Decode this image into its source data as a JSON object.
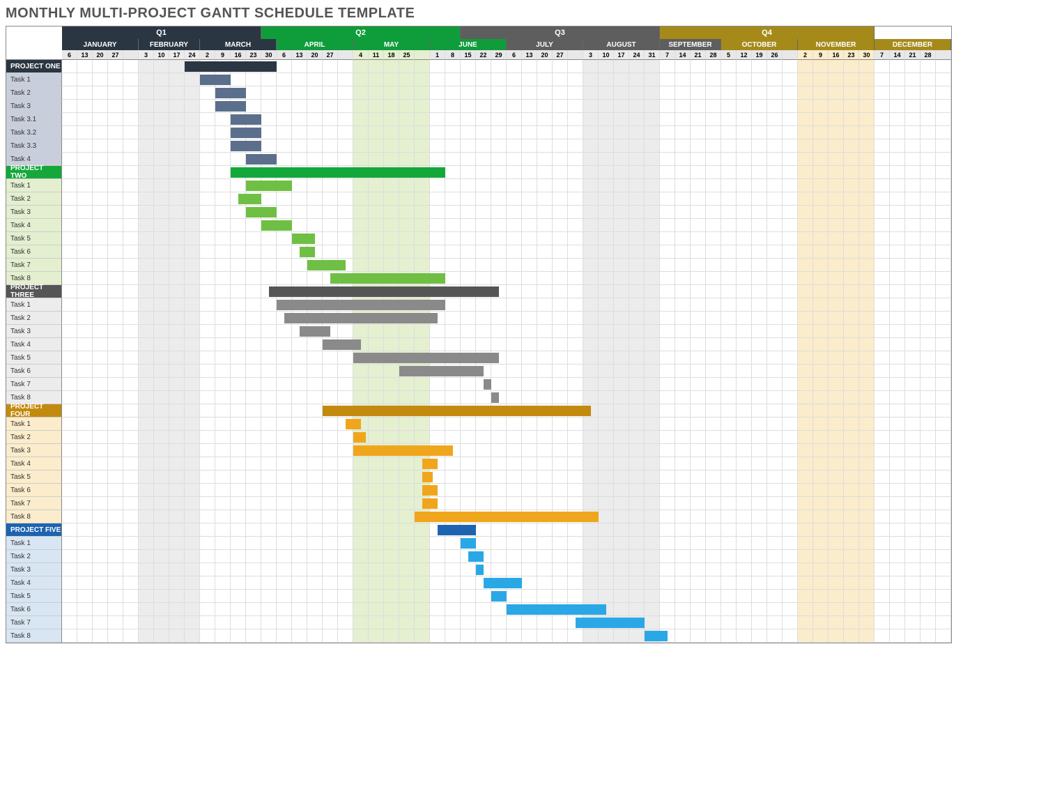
{
  "title": "MONTHLY MULTI-PROJECT GANTT SCHEDULE TEMPLATE",
  "cellWidth": 22,
  "quarters": [
    {
      "name": "Q1",
      "bg": "#2b3643",
      "span": 13
    },
    {
      "name": "Q2",
      "bg": "#0f9c3a",
      "span": 13
    },
    {
      "name": "Q3",
      "bg": "#5e5e5e",
      "span": 13
    },
    {
      "name": "Q4",
      "bg": "#a58a1a",
      "span": 14
    }
  ],
  "months": [
    {
      "name": "JANUARY",
      "bg": "#2b3643",
      "days": [
        6,
        13,
        20,
        27
      ],
      "extra": 1
    },
    {
      "name": "FEBRUARY",
      "bg": "#2b3643",
      "days": [
        3,
        10,
        17,
        24
      ],
      "extra": 0
    },
    {
      "name": "MARCH",
      "bg": "#2b3643",
      "days": [
        2,
        9,
        16,
        23,
        30
      ],
      "extra": 0
    },
    {
      "name": "APRIL",
      "bg": "#0f9c3a",
      "days": [
        6,
        13,
        20,
        27
      ],
      "extra": 1
    },
    {
      "name": "MAY",
      "bg": "#0f9c3a",
      "days": [
        4,
        11,
        18,
        25
      ],
      "extra": 1
    },
    {
      "name": "JUNE",
      "bg": "#0f9c3a",
      "days": [
        1,
        8,
        15,
        22,
        29
      ],
      "extra": 0
    },
    {
      "name": "JULY",
      "bg": "#5e5e5e",
      "days": [
        6,
        13,
        20,
        27
      ],
      "extra": 1
    },
    {
      "name": "AUGUST",
      "bg": "#5e5e5e",
      "days": [
        3,
        10,
        17,
        24,
        31
      ],
      "extra": 0
    },
    {
      "name": "SEPTEMBER",
      "bg": "#5e5e5e",
      "days": [
        7,
        14,
        21,
        28
      ],
      "extra": 0
    },
    {
      "name": "OCTOBER",
      "bg": "#a58a1a",
      "days": [
        5,
        12,
        19,
        26
      ],
      "extra": 1
    },
    {
      "name": "NOVEMBER",
      "bg": "#a58a1a",
      "days": [
        2,
        9,
        16,
        23,
        30
      ],
      "extra": 0
    },
    {
      "name": "DECEMBER",
      "bg": "#a58a1a",
      "days": [
        7,
        14,
        21,
        28
      ],
      "extra": 1
    }
  ],
  "bandColors": {
    "quarterBg": [
      "#fff",
      "#fff",
      "#fff",
      "#fff"
    ],
    "monthShade": {
      "FEBRUARY": "#ececec",
      "MAY": "#e4f0cf",
      "AUGUST": "#ececec",
      "NOVEMBER": "#fbeccb"
    }
  },
  "dayHeaderBg": "#e8e8e8",
  "projects": [
    {
      "name": "PROJECT ONE",
      "hdrBg": "#2b3643",
      "hdrFg": "#fff",
      "rowBg": "#c8cedc",
      "barColor": "#394b63",
      "barMid": "#5b6e8c",
      "rows": [
        {
          "label": "PROJECT ONE",
          "isHeader": true,
          "bar": {
            "start": 8,
            "len": 6,
            "color": "#2b3643"
          }
        },
        {
          "label": "Task 1",
          "bar": {
            "start": 9,
            "len": 2,
            "color": "#5b6e8c"
          }
        },
        {
          "label": "Task 2",
          "bar": {
            "start": 10,
            "len": 2,
            "color": "#5b6e8c"
          }
        },
        {
          "label": "Task 3",
          "bar": {
            "start": 10,
            "len": 2,
            "color": "#5b6e8c"
          }
        },
        {
          "label": "Task 3.1",
          "bar": {
            "start": 11,
            "len": 2,
            "color": "#5b6e8c"
          }
        },
        {
          "label": "Task 3.2",
          "bar": {
            "start": 11,
            "len": 2,
            "color": "#5b6e8c"
          }
        },
        {
          "label": "Task 3.3",
          "bar": {
            "start": 11,
            "len": 2,
            "color": "#5b6e8c"
          }
        },
        {
          "label": "Task 4",
          "bar": {
            "start": 12,
            "len": 2,
            "color": "#5b6e8c"
          }
        }
      ]
    },
    {
      "name": "PROJECT TWO",
      "hdrBg": "#14a83b",
      "hdrFg": "#fff",
      "rowBg": "#e3efcf",
      "barColor": "#14a83b",
      "barMid": "#6fbf44",
      "rows": [
        {
          "label": "PROJECT TWO",
          "isHeader": true,
          "bar": {
            "start": 11,
            "len": 14,
            "color": "#14a83b"
          }
        },
        {
          "label": "Task 1",
          "bar": {
            "start": 12,
            "len": 3,
            "color": "#6fbf44"
          }
        },
        {
          "label": "Task 2",
          "bar": {
            "start": 11.5,
            "len": 1.5,
            "color": "#6fbf44"
          }
        },
        {
          "label": "Task 3",
          "bar": {
            "start": 12,
            "len": 2,
            "color": "#6fbf44"
          }
        },
        {
          "label": "Task 4",
          "bar": {
            "start": 13,
            "len": 2,
            "color": "#6fbf44"
          }
        },
        {
          "label": "Task 5",
          "bar": {
            "start": 15,
            "len": 1.5,
            "color": "#6fbf44"
          }
        },
        {
          "label": "Task 6",
          "bar": {
            "start": 15.5,
            "len": 1,
            "color": "#6fbf44"
          }
        },
        {
          "label": "Task 7",
          "bar": {
            "start": 16,
            "len": 2.5,
            "color": "#6fbf44"
          }
        },
        {
          "label": "Task 8",
          "bar": {
            "start": 17.5,
            "len": 7.5,
            "color": "#6fbf44"
          }
        }
      ]
    },
    {
      "name": "PROJECT THREE",
      "hdrBg": "#555",
      "hdrFg": "#fff",
      "rowBg": "#ececec",
      "barColor": "#555",
      "barMid": "#8a8a8a",
      "rows": [
        {
          "label": "PROJECT THREE",
          "isHeader": true,
          "bar": {
            "start": 13.5,
            "len": 15,
            "color": "#555"
          }
        },
        {
          "label": "Task 1",
          "bar": {
            "start": 14,
            "len": 11,
            "color": "#8a8a8a"
          }
        },
        {
          "label": "Task 2",
          "bar": {
            "start": 14.5,
            "len": 10,
            "color": "#8a8a8a"
          }
        },
        {
          "label": "Task 3",
          "bar": {
            "start": 15.5,
            "len": 2,
            "color": "#8a8a8a"
          }
        },
        {
          "label": "Task 4",
          "bar": {
            "start": 17,
            "len": 2.5,
            "color": "#8a8a8a"
          }
        },
        {
          "label": "Task 5",
          "bar": {
            "start": 19,
            "len": 9.5,
            "color": "#8a8a8a"
          }
        },
        {
          "label": "Task 6",
          "bar": {
            "start": 22,
            "len": 5.5,
            "color": "#8a8a8a"
          }
        },
        {
          "label": "Task 7",
          "bar": {
            "start": 27.5,
            "len": 0.5,
            "color": "#8a8a8a"
          }
        },
        {
          "label": "Task 8",
          "bar": {
            "start": 28,
            "len": 0.5,
            "color": "#8a8a8a"
          }
        }
      ]
    },
    {
      "name": "PROJECT FOUR",
      "hdrBg": "#c28a0e",
      "hdrFg": "#fff",
      "rowBg": "#fbeccb",
      "barColor": "#c28a0e",
      "barMid": "#f0a61c",
      "rows": [
        {
          "label": "PROJECT FOUR",
          "isHeader": true,
          "bar": {
            "start": 17,
            "len": 17.5,
            "color": "#c28a0e"
          }
        },
        {
          "label": "Task 1",
          "bar": {
            "start": 18.5,
            "len": 1,
            "color": "#f0a61c"
          }
        },
        {
          "label": "Task 2",
          "bar": {
            "start": 19,
            "len": 0.8,
            "color": "#f0a61c"
          }
        },
        {
          "label": "Task 3",
          "bar": {
            "start": 19,
            "len": 6.5,
            "color": "#f0a61c"
          }
        },
        {
          "label": "Task 4",
          "bar": {
            "start": 23.5,
            "len": 1,
            "color": "#f0a61c"
          }
        },
        {
          "label": "Task 5",
          "bar": {
            "start": 23.5,
            "len": 0.7,
            "color": "#f0a61c"
          }
        },
        {
          "label": "Task 6",
          "bar": {
            "start": 23.5,
            "len": 1,
            "color": "#f0a61c"
          }
        },
        {
          "label": "Task 7",
          "bar": {
            "start": 23.5,
            "len": 1,
            "color": "#f0a61c"
          }
        },
        {
          "label": "Task 8",
          "bar": {
            "start": 23,
            "len": 12,
            "color": "#f0a61c"
          }
        }
      ]
    },
    {
      "name": "PROJECT FIVE",
      "hdrBg": "#1e63b0",
      "hdrFg": "#fff",
      "rowBg": "#d8e6f3",
      "barColor": "#1e63b0",
      "barMid": "#2aa8e6",
      "rows": [
        {
          "label": "PROJECT FIVE",
          "isHeader": true,
          "bar": {
            "start": 24.5,
            "len": 2.5,
            "color": "#1e63b0"
          }
        },
        {
          "label": "Task 1",
          "bar": {
            "start": 26,
            "len": 1,
            "color": "#2aa8e6"
          }
        },
        {
          "label": "Task 2",
          "bar": {
            "start": 26.5,
            "len": 1,
            "color": "#2aa8e6"
          }
        },
        {
          "label": "Task 3",
          "bar": {
            "start": 27,
            "len": 0.5,
            "color": "#2aa8e6"
          }
        },
        {
          "label": "Task 4",
          "bar": {
            "start": 27.5,
            "len": 2.5,
            "color": "#2aa8e6"
          }
        },
        {
          "label": "Task 5",
          "bar": {
            "start": 28,
            "len": 1,
            "color": "#2aa8e6"
          }
        },
        {
          "label": "Task 6",
          "bar": {
            "start": 29,
            "len": 6.5,
            "color": "#2aa8e6"
          }
        },
        {
          "label": "Task 7",
          "bar": {
            "start": 33.5,
            "len": 4.5,
            "color": "#2aa8e6"
          }
        },
        {
          "label": "Task 8",
          "bar": {
            "start": 38,
            "len": 1.5,
            "color": "#2aa8e6"
          }
        }
      ]
    }
  ],
  "chart_data": {
    "type": "gantt",
    "title": "MONTHLY MULTI-PROJECT GANTT SCHEDULE TEMPLATE",
    "x_unit": "week_index (0 = first week column)",
    "columns_total": 53,
    "quarters": [
      "Q1",
      "Q2",
      "Q3",
      "Q4"
    ],
    "months": [
      "JANUARY",
      "FEBRUARY",
      "MARCH",
      "APRIL",
      "MAY",
      "JUNE",
      "JULY",
      "AUGUST",
      "SEPTEMBER",
      "OCTOBER",
      "NOVEMBER",
      "DECEMBER"
    ],
    "week_labels": [
      6,
      13,
      20,
      27,
      null,
      3,
      10,
      17,
      24,
      2,
      9,
      16,
      23,
      30,
      6,
      13,
      20,
      27,
      null,
      4,
      11,
      18,
      25,
      null,
      1,
      8,
      15,
      22,
      29,
      6,
      13,
      20,
      27,
      null,
      3,
      10,
      17,
      24,
      31,
      7,
      14,
      21,
      28,
      5,
      12,
      19,
      26,
      null,
      2,
      9,
      16,
      23,
      30,
      7,
      14,
      21,
      28,
      null
    ],
    "series": [
      {
        "name": "PROJECT ONE",
        "color": "#2b3643",
        "tasks": [
          {
            "name": "(summary)",
            "start": 8,
            "end": 14
          },
          {
            "name": "Task 1",
            "start": 9,
            "end": 11
          },
          {
            "name": "Task 2",
            "start": 10,
            "end": 12
          },
          {
            "name": "Task 3",
            "start": 10,
            "end": 12
          },
          {
            "name": "Task 3.1",
            "start": 11,
            "end": 13
          },
          {
            "name": "Task 3.2",
            "start": 11,
            "end": 13
          },
          {
            "name": "Task 3.3",
            "start": 11,
            "end": 13
          },
          {
            "name": "Task 4",
            "start": 12,
            "end": 14
          }
        ]
      },
      {
        "name": "PROJECT TWO",
        "color": "#14a83b",
        "tasks": [
          {
            "name": "(summary)",
            "start": 11,
            "end": 25
          },
          {
            "name": "Task 1",
            "start": 12,
            "end": 15
          },
          {
            "name": "Task 2",
            "start": 11.5,
            "end": 13
          },
          {
            "name": "Task 3",
            "start": 12,
            "end": 14
          },
          {
            "name": "Task 4",
            "start": 13,
            "end": 15
          },
          {
            "name": "Task 5",
            "start": 15,
            "end": 16.5
          },
          {
            "name": "Task 6",
            "start": 15.5,
            "end": 16.5
          },
          {
            "name": "Task 7",
            "start": 16,
            "end": 18.5
          },
          {
            "name": "Task 8",
            "start": 17.5,
            "end": 25
          }
        ]
      },
      {
        "name": "PROJECT THREE",
        "color": "#555555",
        "tasks": [
          {
            "name": "(summary)",
            "start": 13.5,
            "end": 28.5
          },
          {
            "name": "Task 1",
            "start": 14,
            "end": 25
          },
          {
            "name": "Task 2",
            "start": 14.5,
            "end": 24.5
          },
          {
            "name": "Task 3",
            "start": 15.5,
            "end": 17.5
          },
          {
            "name": "Task 4",
            "start": 17,
            "end": 19.5
          },
          {
            "name": "Task 5",
            "start": 19,
            "end": 28.5
          },
          {
            "name": "Task 6",
            "start": 22,
            "end": 27.5
          },
          {
            "name": "Task 7",
            "start": 27.5,
            "end": 28
          },
          {
            "name": "Task 8",
            "start": 28,
            "end": 28.5
          }
        ]
      },
      {
        "name": "PROJECT FOUR",
        "color": "#c28a0e",
        "tasks": [
          {
            "name": "(summary)",
            "start": 17,
            "end": 34.5
          },
          {
            "name": "Task 1",
            "start": 18.5,
            "end": 19.5
          },
          {
            "name": "Task 2",
            "start": 19,
            "end": 19.8
          },
          {
            "name": "Task 3",
            "start": 19,
            "end": 25.5
          },
          {
            "name": "Task 4",
            "start": 23.5,
            "end": 24.5
          },
          {
            "name": "Task 5",
            "start": 23.5,
            "end": 24.2
          },
          {
            "name": "Task 6",
            "start": 23.5,
            "end": 24.5
          },
          {
            "name": "Task 7",
            "start": 23.5,
            "end": 24.5
          },
          {
            "name": "Task 8",
            "start": 23,
            "end": 35
          }
        ]
      },
      {
        "name": "PROJECT FIVE",
        "color": "#1e63b0",
        "tasks": [
          {
            "name": "(summary)",
            "start": 24.5,
            "end": 27
          },
          {
            "name": "Task 1",
            "start": 26,
            "end": 27
          },
          {
            "name": "Task 2",
            "start": 26.5,
            "end": 27.5
          },
          {
            "name": "Task 3",
            "start": 27,
            "end": 27.5
          },
          {
            "name": "Task 4",
            "start": 27.5,
            "end": 30
          },
          {
            "name": "Task 5",
            "start": 28,
            "end": 29
          },
          {
            "name": "Task 6",
            "start": 29,
            "end": 35.5
          },
          {
            "name": "Task 7",
            "start": 33.5,
            "end": 38
          },
          {
            "name": "Task 8",
            "start": 38,
            "end": 39.5
          }
        ]
      }
    ]
  }
}
